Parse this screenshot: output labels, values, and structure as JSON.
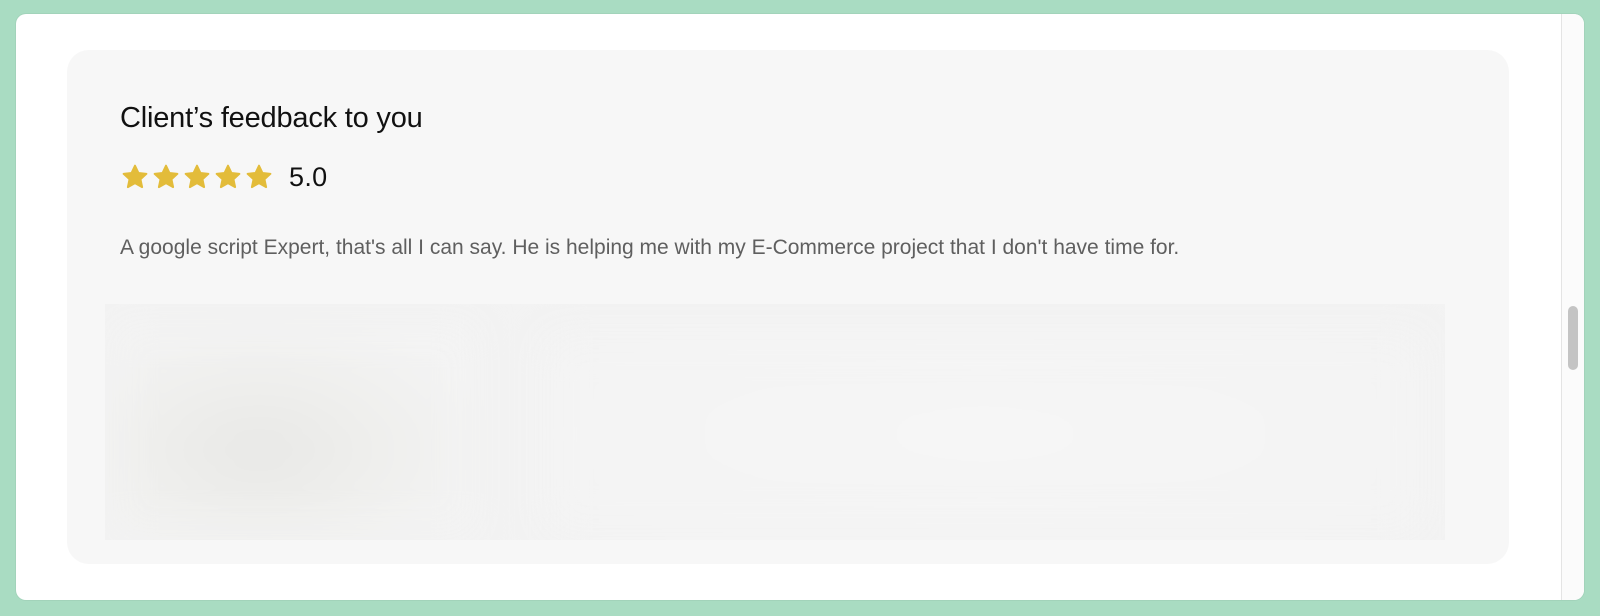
{
  "feedback": {
    "title": "Client’s feedback to you",
    "rating": {
      "value_text": "5.0",
      "stars_filled": 5,
      "stars_total": 5,
      "star_color": "#E3BC3A"
    },
    "comment": "A google script Expert, that's all I can say. He is helping me with my E-Commerce project that I don't have time for."
  },
  "colors": {
    "background": "#A9DCC2",
    "card": "#F7F7F7",
    "title_text": "#111111",
    "body_text": "#5F5F5F"
  }
}
